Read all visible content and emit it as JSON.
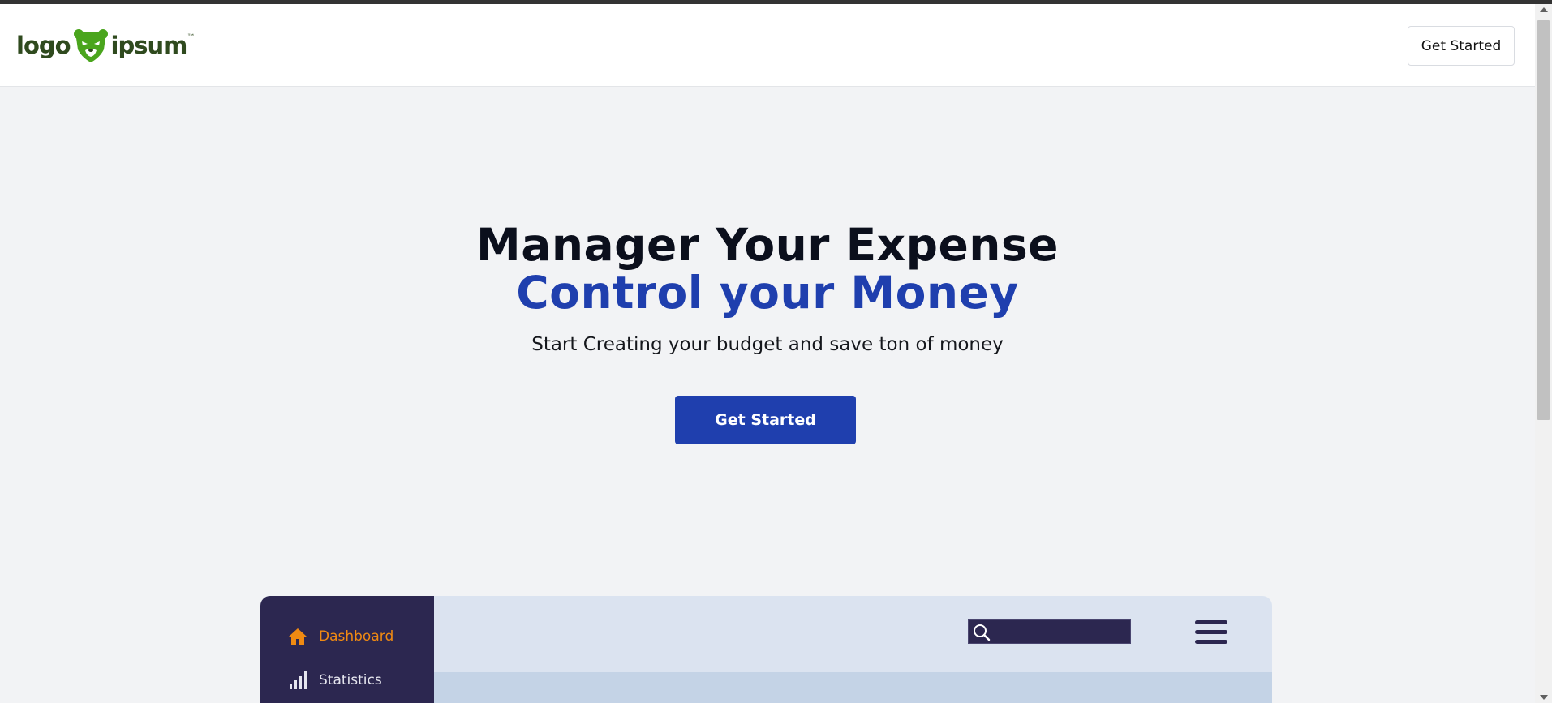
{
  "header": {
    "logo": {
      "word_left": "logo",
      "word_right": "ipsum",
      "tm": "™",
      "mark_color": "#4aa51d",
      "text_color": "#2f4a1e"
    },
    "cta_label": "Get Started"
  },
  "hero": {
    "line1": "Manager Your Expense",
    "line2": "Control your Money",
    "subtitle": "Start Creating your budget and save ton of money",
    "cta_label": "Get Started",
    "accent_color": "#1f3fae"
  },
  "preview": {
    "sidebar": [
      {
        "label": "Dashboard",
        "icon": "home-icon",
        "active": true,
        "color": "#f08a12"
      },
      {
        "label": "Statistics",
        "icon": "bar-chart-icon",
        "active": false
      }
    ],
    "search_icon": "search-icon",
    "menu_icon": "hamburger-menu-icon"
  }
}
